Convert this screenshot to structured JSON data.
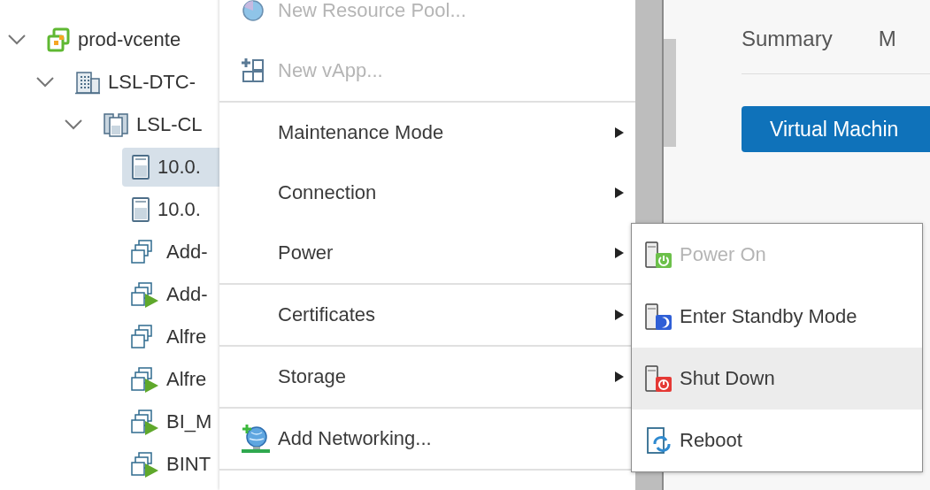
{
  "tree": [
    {
      "label": "prod-vcente",
      "kind": "vcenter",
      "expanded": true,
      "selected": false,
      "children": [
        {
          "label": "LSL-DTC-",
          "kind": "datacenter",
          "expanded": true,
          "selected": false,
          "children": [
            {
              "label": "LSL-CL",
              "kind": "cluster",
              "expanded": true,
              "selected": false,
              "children": [
                {
                  "label": "10.0.",
                  "kind": "host",
                  "selected": true
                },
                {
                  "label": "10.0.",
                  "kind": "host",
                  "selected": false
                },
                {
                  "label": "Add-",
                  "kind": "vm",
                  "running": false,
                  "selected": false
                },
                {
                  "label": "Add-",
                  "kind": "vm",
                  "running": true,
                  "selected": false
                },
                {
                  "label": "Alfre",
                  "kind": "vm",
                  "running": false,
                  "selected": false
                },
                {
                  "label": "Alfre",
                  "kind": "vm",
                  "running": true,
                  "selected": false
                },
                {
                  "label": "BI_M",
                  "kind": "vm",
                  "running": true,
                  "selected": false
                },
                {
                  "label": "BINT",
                  "kind": "vm",
                  "running": true,
                  "selected": false
                }
              ]
            }
          ]
        }
      ]
    }
  ],
  "context_menu": {
    "sections": [
      [
        {
          "label": "New Resource Pool...",
          "kind": "resource-pool",
          "disabled": true,
          "submenu": false
        },
        {
          "label": "New vApp...",
          "kind": "vapp",
          "disabled": true,
          "submenu": false
        }
      ],
      [
        {
          "label": "Maintenance Mode",
          "kind": "plain",
          "disabled": false,
          "submenu": true
        },
        {
          "label": "Connection",
          "kind": "plain",
          "disabled": false,
          "submenu": true
        },
        {
          "label": "Power",
          "kind": "plain",
          "disabled": false,
          "submenu": true
        }
      ],
      [
        {
          "label": "Certificates",
          "kind": "plain",
          "disabled": false,
          "submenu": true
        }
      ],
      [
        {
          "label": "Storage",
          "kind": "plain",
          "disabled": false,
          "submenu": true
        }
      ],
      [
        {
          "label": "Add Networking...",
          "kind": "network",
          "disabled": false,
          "submenu": false
        }
      ]
    ]
  },
  "power_submenu": [
    {
      "label": "Power On",
      "kind": "power-on",
      "disabled": true,
      "selected": false
    },
    {
      "label": "Enter Standby Mode",
      "kind": "standby",
      "disabled": false,
      "selected": false
    },
    {
      "label": "Shut Down",
      "kind": "shut-down",
      "disabled": false,
      "selected": true
    },
    {
      "label": "Reboot",
      "kind": "reboot",
      "disabled": false,
      "selected": false
    }
  ],
  "detail": {
    "tabs": [
      {
        "label": "Summary"
      },
      {
        "label": "M"
      }
    ],
    "button": "Virtual Machin"
  }
}
